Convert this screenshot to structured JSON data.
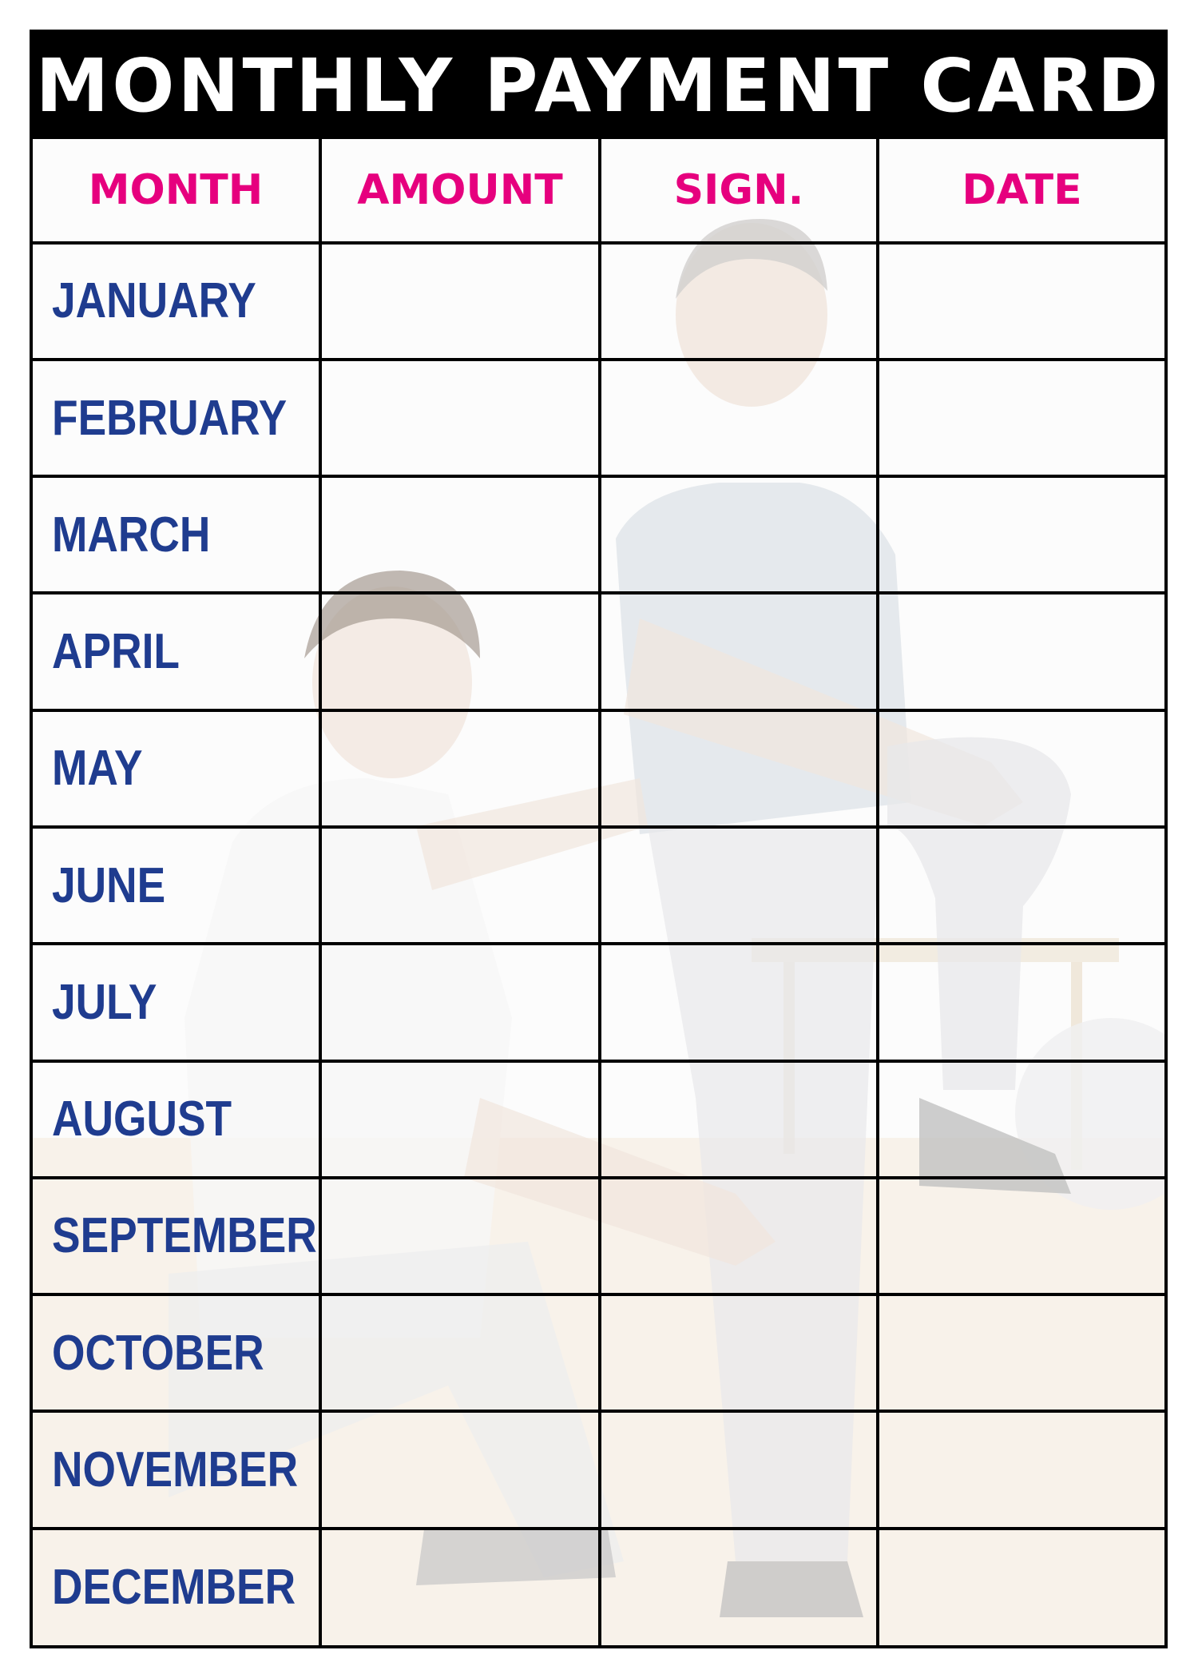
{
  "card": {
    "title": "MONTHLY PAYMENT CARD",
    "columns": [
      "MONTH",
      "AMOUNT",
      "SIGN.",
      "DATE"
    ],
    "months": [
      "JANUARY",
      "FEBRUARY",
      "MARCH",
      "APRIL",
      "MAY",
      "JUNE",
      "JULY",
      "AUGUST",
      "SEPTEMBER",
      "OCTOBER",
      "NOVEMBER",
      "DECEMBER"
    ]
  },
  "colors": {
    "title_bar": "#000000",
    "title_text": "#ffffff",
    "header_text": "#e6007e",
    "month_text": "#1f3c8f",
    "grid_lines": "#000000"
  }
}
